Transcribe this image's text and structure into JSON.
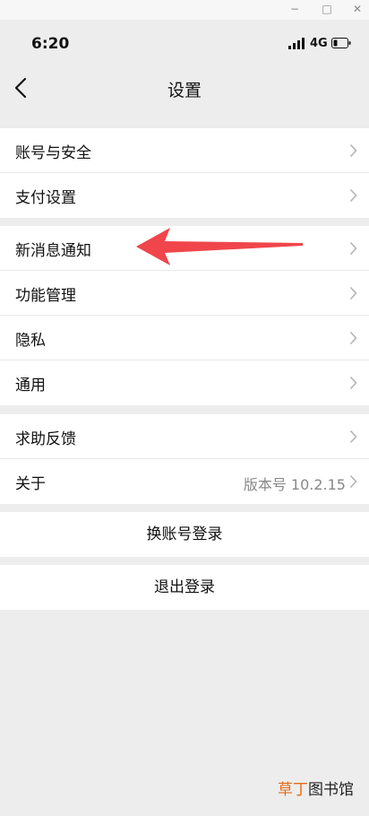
{
  "window_controls": {
    "minimize": "−",
    "maximize": "□",
    "close": "✕"
  },
  "status_bar": {
    "time": "6:20",
    "network": "4G",
    "signal_icon": "signal-icon",
    "battery_icon": "battery-icon"
  },
  "nav": {
    "title": "设置",
    "back_icon": "back-chevron-icon"
  },
  "groups": [
    {
      "items": [
        {
          "label": "账号与安全"
        },
        {
          "label": "支付设置"
        }
      ]
    },
    {
      "items": [
        {
          "label": "新消息通知"
        },
        {
          "label": "功能管理"
        },
        {
          "label": "隐私"
        },
        {
          "label": "通用"
        }
      ]
    },
    {
      "items": [
        {
          "label": "求助反馈"
        },
        {
          "label": "关于",
          "value": "版本号 10.2.15"
        }
      ]
    }
  ],
  "actions": {
    "switch_account": "换账号登录",
    "logout": "退出登录"
  },
  "annotation": {
    "arrow_color": "#f0464b"
  },
  "watermark": {
    "part1": "草丁",
    "part2": "图书馆"
  },
  "colors": {
    "background": "#ededed",
    "card": "#ffffff",
    "secondary_text": "#888888"
  }
}
